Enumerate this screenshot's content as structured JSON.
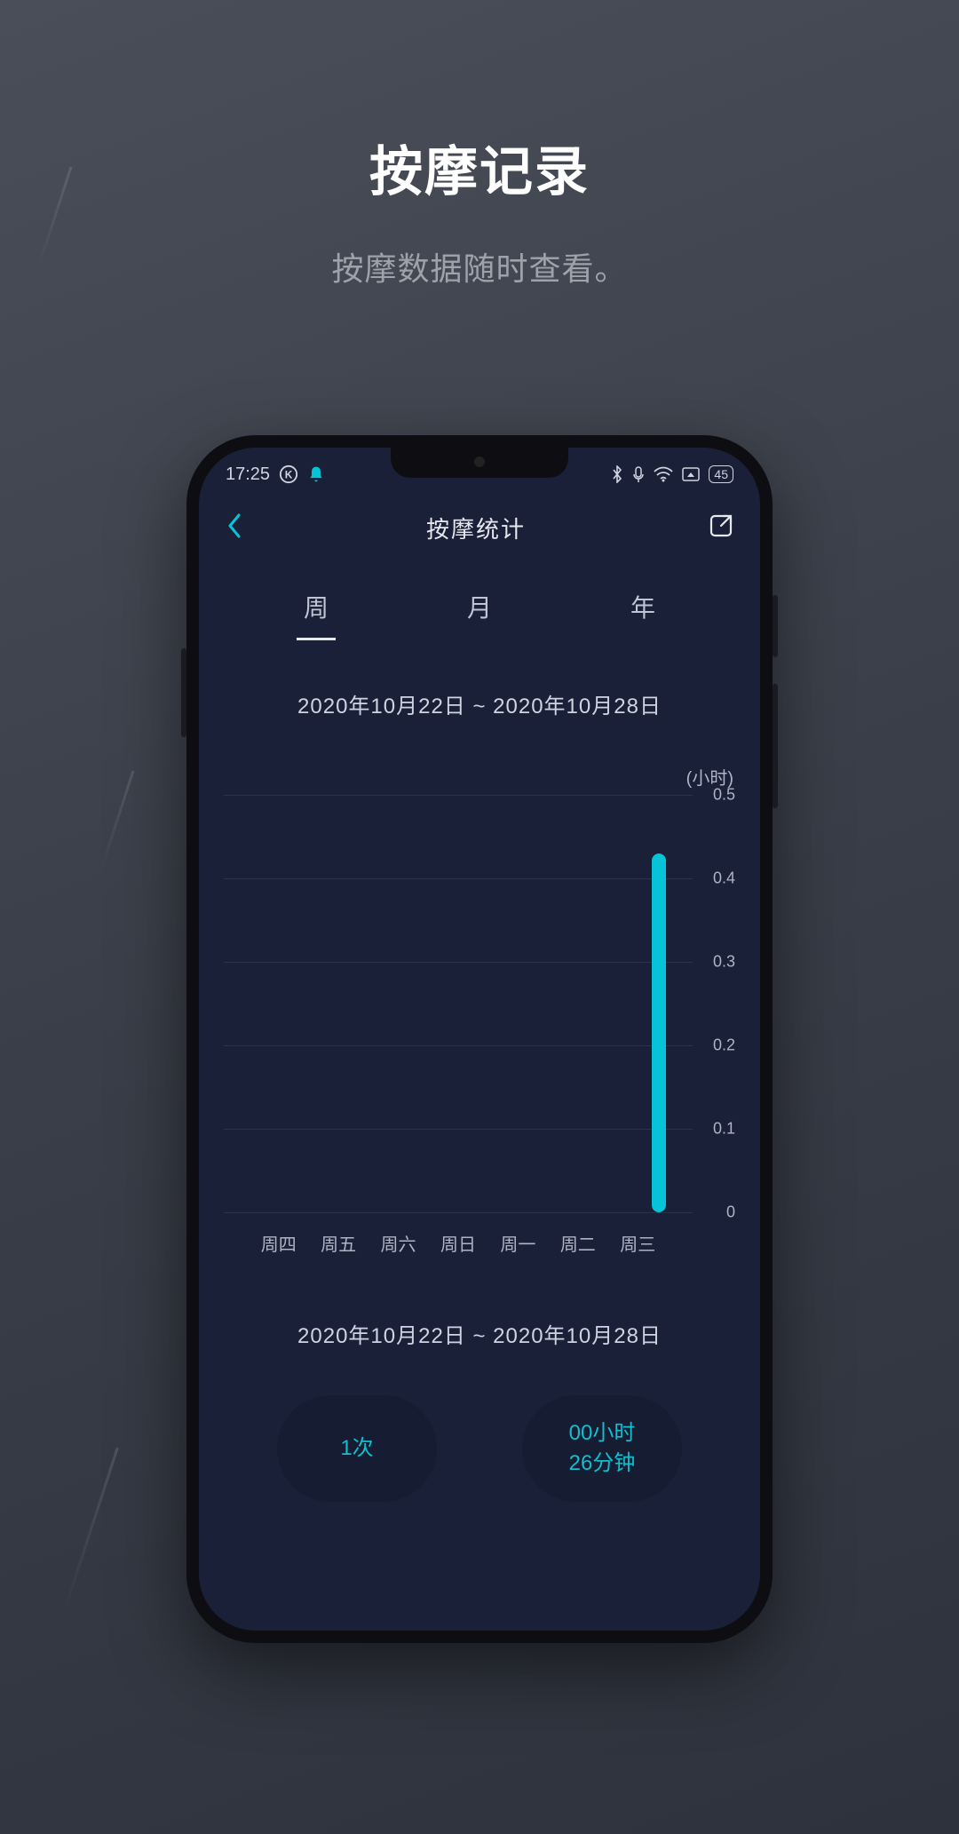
{
  "promo": {
    "title": "按摩记录",
    "subtitle": "按摩数据随时查看。"
  },
  "status": {
    "time": "17:25",
    "battery": "45"
  },
  "nav": {
    "title": "按摩统计"
  },
  "tabs": {
    "week": "周",
    "month": "月",
    "year": "年"
  },
  "date_range": "2020年10月22日 ~ 2020年10月28日",
  "chart_data": {
    "type": "bar",
    "unit_label": "(小时)",
    "categories": [
      "周四",
      "周五",
      "周六",
      "周日",
      "周一",
      "周二",
      "周三"
    ],
    "values": [
      0,
      0,
      0,
      0,
      0,
      0,
      0.43
    ],
    "ylabel": "小时",
    "yticks": [
      "0",
      "0.1",
      "0.2",
      "0.3",
      "0.4",
      "0.5"
    ],
    "ylim": [
      0,
      0.5
    ]
  },
  "date_range_2": "2020年10月22日 ~ 2020年10月28日",
  "summary": {
    "count": "1次",
    "duration_line1": "00小时",
    "duration_line2": "26分钟"
  },
  "colors": {
    "accent": "#06c3d8"
  }
}
